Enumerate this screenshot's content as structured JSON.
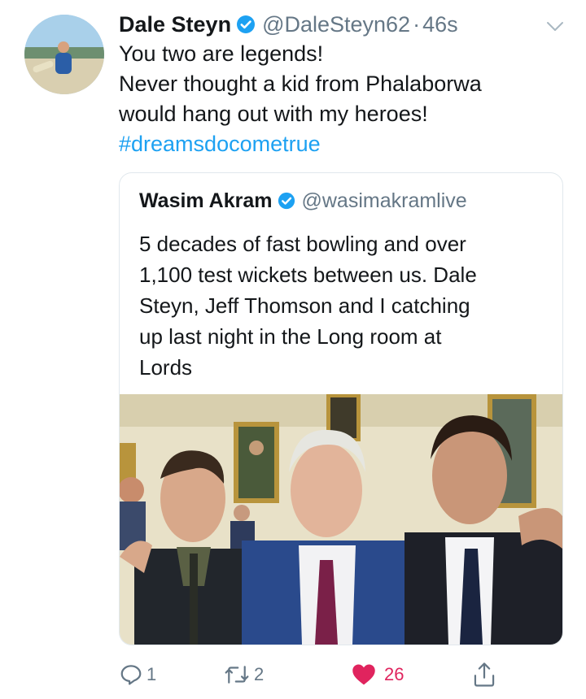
{
  "tweet": {
    "author_name": "Dale Steyn",
    "author_handle": "@DaleSteyn62",
    "separator": "·",
    "time": "46s",
    "lines": [
      "You two are legends!",
      "Never thought a kid from Phalaborwa",
      "would hang out with my heroes!"
    ],
    "hashtag": "#dreamsdocometrue"
  },
  "quoted": {
    "author_name": "Wasim Akram",
    "author_handle": "@wasimakramlive",
    "lines": [
      "5 decades of fast bowling and over",
      "1,100 test wickets between us. Dale",
      "Steyn, Jeff Thomson and I catching",
      "up last night in the Long room at",
      "Lords"
    ]
  },
  "actions": {
    "reply_count": "1",
    "retweet_count": "2",
    "like_count": "26"
  },
  "icons": {
    "verified": "verified-badge-icon",
    "menu": "chevron-down-icon",
    "reply": "reply-icon",
    "retweet": "retweet-icon",
    "like": "heart-icon",
    "share": "share-icon"
  },
  "colors": {
    "verified": "#1da1f2",
    "hashtag": "#1da1f2",
    "secondary_text": "#657786",
    "like": "#e0245e"
  }
}
